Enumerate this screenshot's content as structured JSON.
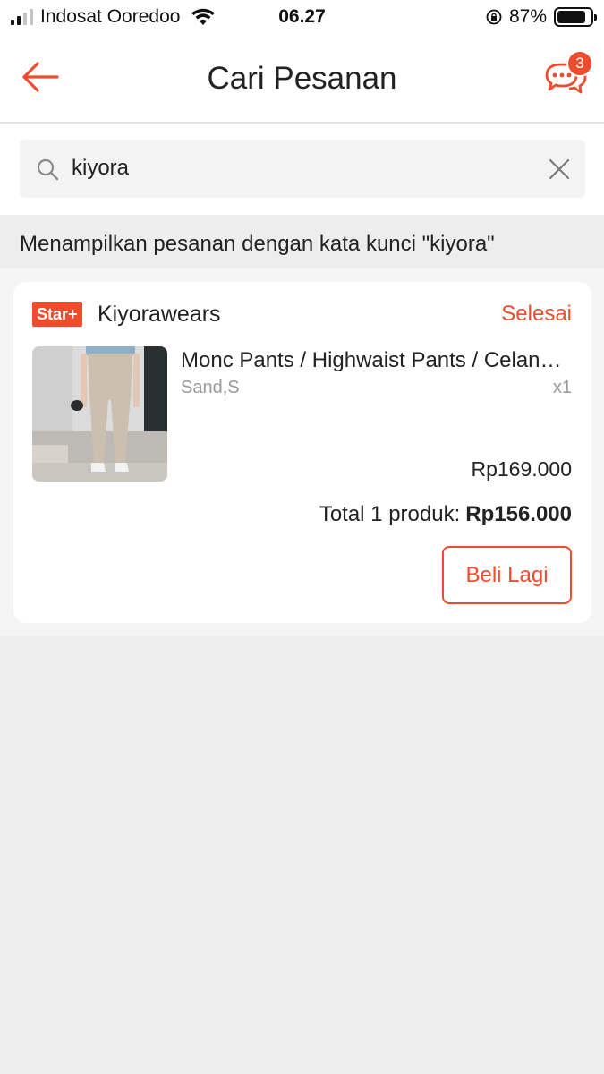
{
  "status_bar": {
    "carrier": "Indosat Ooredoo",
    "time": "06.27",
    "battery": "87%",
    "battery_level": 0.87
  },
  "header": {
    "title": "Cari Pesanan",
    "chat_badge": "3"
  },
  "search": {
    "value": "kiyora"
  },
  "result_info": "Menampilkan pesanan dengan kata kunci \"kiyora\"",
  "order": {
    "badge": "Star+",
    "shop_name": "Kiyorawears",
    "status": "Selesai",
    "product": {
      "name": "Monc Pants / Highwaist Pants / Celana Kulot",
      "variant": "Sand,S",
      "quantity": "x1",
      "price": "Rp169.000"
    },
    "total_label": "Total 1 produk:",
    "total_amount": "Rp156.000",
    "buy_again_label": "Beli Lagi"
  },
  "colors": {
    "accent": "#ee4d2d",
    "background": "#ededed",
    "muted_text": "#9a9a9a"
  },
  "icons": [
    "back-arrow-icon",
    "chat-icon",
    "search-icon",
    "close-icon",
    "wifi-icon",
    "rotation-lock-icon",
    "battery-icon"
  ]
}
